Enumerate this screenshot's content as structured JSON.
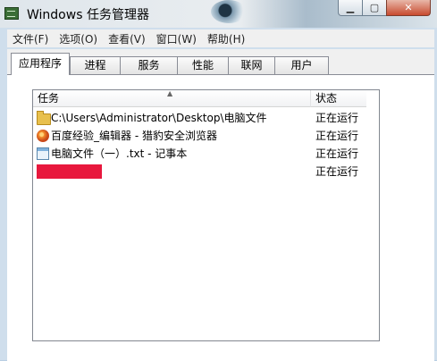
{
  "window": {
    "title": "Windows 任务管理器",
    "buttons": {
      "minimize": "▁",
      "maximize": "▢",
      "close": "✕"
    }
  },
  "menubar": {
    "items": [
      "文件(F)",
      "选项(O)",
      "查看(V)",
      "窗口(W)",
      "帮助(H)"
    ]
  },
  "tabs": {
    "items": [
      "应用程序",
      "进程",
      "服务",
      "性能",
      "联网",
      "用户"
    ],
    "active": "应用程序"
  },
  "list": {
    "columns": {
      "task": "任务",
      "status": "状态"
    },
    "rows": [
      {
        "icon": "folder-icon",
        "task": "C:\\Users\\Administrator\\Desktop\\电脑文件",
        "status": "正在运行"
      },
      {
        "icon": "browser-icon",
        "task": "百度经验_编辑器 - 猎豹安全浏览器",
        "status": "正在运行"
      },
      {
        "icon": "notepad-icon",
        "task": "电脑文件（一）.txt - 记事本",
        "status": "正在运行"
      },
      {
        "icon": "redacted",
        "task": "",
        "status": "正在运行"
      }
    ]
  },
  "colors": {
    "redaction": "#e8183d",
    "frame": "#cfdeec"
  }
}
